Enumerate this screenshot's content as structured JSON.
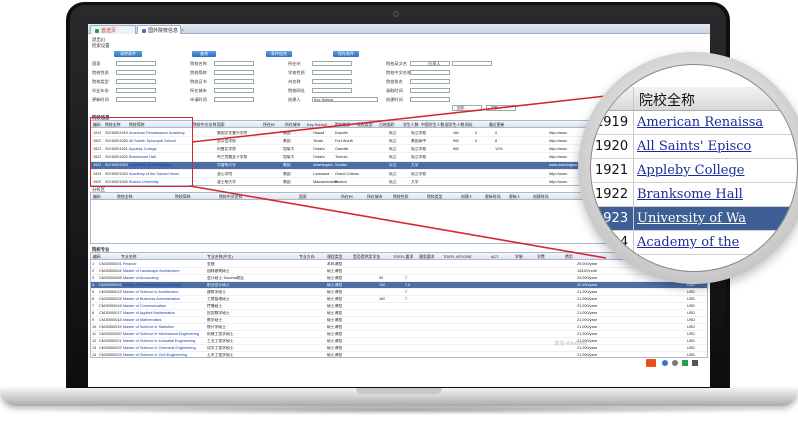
{
  "tabs": [
    {
      "label": "首选页",
      "color": "#2e9a4a"
    },
    {
      "label": "国外院校信息",
      "color": "#3a74c6"
    }
  ],
  "filters": {
    "title": "退出(I)",
    "subtitle": "检索设置",
    "buttons": [
      "清除条件",
      "查询",
      "条件组合",
      "保存条件"
    ],
    "labels": [
      "国家",
      "院校名称",
      "所在州",
      "院校英文名",
      "院校性质",
      "院校简称",
      "学校性质",
      "院校中文名称",
      "院校类型",
      "院校证书",
      "州名称",
      "院校排名",
      "毕业年份",
      "所在城市",
      "院校网址",
      "录取时间",
      "更新时间",
      "申请时间",
      "创建人",
      "创建时间",
      "分享人"
    ],
    "dropdowns": [
      "Key School",
      "- 全部 -",
      "- 全部 -"
    ]
  },
  "school_grid": {
    "section_title": "院校信息",
    "columns": [
      "编码",
      "院校全称",
      "院校简称",
      "院校中文名称",
      "国家",
      "所在州",
      "所在城市",
      "Key School",
      "院校性质",
      "院校类型",
      "占地面积",
      "学生人数",
      "中国学生人数",
      "留学生人数",
      "网址",
      "最近更新"
    ],
    "rows": [
      {
        "no": "1919",
        "code": "SCH0001919",
        "name": "American Renaissance Academy",
        "cn": "美国文艺复兴学院",
        "country": "美国",
        "state": "Hawaii",
        "city": "Kapolei",
        "nature": "私立",
        "type": "私立学校",
        "stu": "160",
        "cn_stu": "0",
        "intl": "0",
        "url": "http://www."
      },
      {
        "no": "1920",
        "code": "SCH0001920",
        "name": "All Saints' Episcopal School",
        "cn": "圣公会学校",
        "country": "美国",
        "state": "Texas",
        "city": "Fort Worth",
        "nature": "私立",
        "type": "美国高中",
        "stu": "900",
        "cn_stu": "0",
        "intl": "8",
        "url": "http://www."
      },
      {
        "no": "1921",
        "code": "SCH0001921",
        "name": "Appleby College",
        "cn": "阿普比学院",
        "country": "加拿大",
        "state": "Ontario",
        "city": "Oakville",
        "nature": "私立",
        "type": "私立学校",
        "stu": "800",
        "cn_stu": "",
        "intl": "12%",
        "url": "http://www."
      },
      {
        "no": "1922",
        "code": "SCH0001922",
        "name": "Branksome Hall",
        "cn": "布兰克森女子学校",
        "country": "加拿大",
        "state": "Ontario",
        "city": "Toronto",
        "nature": "私立",
        "type": "私立学校",
        "stu": "",
        "cn_stu": "",
        "intl": "",
        "url": "http://www."
      },
      {
        "no": "1923",
        "code": "SCH0001923",
        "name": "University of Washington",
        "cn": "华盛顿大学",
        "country": "美国",
        "state": "Washington",
        "city": "Seattle",
        "nature": "公立",
        "type": "大学",
        "stu": "",
        "cn_stu": "",
        "intl": "",
        "url": "www.washington"
      },
      {
        "no": "1924",
        "code": "SCH0001924",
        "name": "Academy of the Sacred Heart",
        "cn": "圣心学院",
        "country": "美国",
        "state": "Louisiana",
        "city": "Grand Coteau",
        "nature": "私立",
        "type": "私立学校",
        "stu": "",
        "cn_stu": "",
        "intl": "",
        "url": "http://www."
      },
      {
        "no": "1925",
        "code": "SCH0001925",
        "name": "Boston University",
        "cn": "波士顿大学",
        "country": "美国",
        "state": "Massachusetts",
        "city": "Boston",
        "nature": "私立",
        "type": "大学",
        "stu": "",
        "cn_stu": "",
        "intl": "",
        "url": "http://www."
      }
    ],
    "selected_index": 4
  },
  "branch_grid": {
    "section_title": "分校区",
    "columns": [
      "编码",
      "院校全称",
      "院校简称",
      "院校中文名称",
      "国家",
      "所在州",
      "所在城市",
      "院校性质",
      "院校类型",
      "创建人",
      "更新时间",
      "更新人",
      "创建时间"
    ]
  },
  "major_grid": {
    "section_title": "院校专业",
    "columns": [
      "编码",
      "专业名称",
      "专业名称(中文)",
      "专业方向",
      "课程类型",
      "是否提供奖学金",
      "TOEFL要求",
      "雅思要求",
      "TOEFL iBT/GRE",
      "ACT",
      "学制",
      "学费",
      "费用"
    ],
    "rows": [
      {
        "code": "CMJ0000001",
        "name": "Finance",
        "cn": "金融",
        "type": "本科课程",
        "toefl": "",
        "ielts": "",
        "fee": "29,000/year",
        "fee2": ""
      },
      {
        "code": "CMJ0000004",
        "name": "Master of Landscape Architecture",
        "cn": "园林建筑硕士",
        "type": "硕士课程",
        "toefl": "",
        "ielts": "",
        "fee": "1443/Credit",
        "fee2": ""
      },
      {
        "code": "CMJ0000008",
        "name": "Master of Accounting",
        "cn": "会计硕士-Tacoma校区",
        "type": "硕士课程",
        "toefl": "90",
        "ielts": "7",
        "fee": "24,000/year",
        "fee2": "USD"
      },
      {
        "code": "CMJ0000012",
        "name": "Master of Professional Accounting",
        "cn": "职业会计硕士",
        "type": "硕士课程",
        "toefl": "100",
        "ielts": "7.0",
        "fee": "32,900/year",
        "fee2": "USD"
      },
      {
        "code": "CMJ0000013",
        "name": "Master of Science in Architecture",
        "cn": "建筑学硕士",
        "type": "硕士课程",
        "toefl": "",
        "ielts": "7",
        "fee": "21,000/year",
        "fee2": "USD"
      },
      {
        "code": "CMJ0000015",
        "name": "Master of Business Administration",
        "cn": "工商管理硕士",
        "type": "硕士课程",
        "toefl": "100",
        "ielts": "7",
        "fee": "21,000/year",
        "fee2": "USD"
      },
      {
        "code": "CMJ0000016",
        "name": "Master of Communication",
        "cn": "传播硕士",
        "type": "硕士课程",
        "toefl": "",
        "ielts": "",
        "fee": "21,000/year",
        "fee2": "USD"
      },
      {
        "code": "CMJ0000017",
        "name": "Master of Applied Mathematics",
        "cn": "应用数学硕士",
        "type": "硕士课程",
        "toefl": "",
        "ielts": "",
        "fee": "21,000/year",
        "fee2": "USD"
      },
      {
        "code": "CMJ0000018",
        "name": "Master of Mathematics",
        "cn": "数学硕士",
        "type": "硕士课程",
        "toefl": "",
        "ielts": "",
        "fee": "21,000/year",
        "fee2": "USD"
      },
      {
        "code": "CMJ0000019",
        "name": "Master of Science in Statistics",
        "cn": "统计学硕士",
        "type": "硕士课程",
        "toefl": "",
        "ielts": "",
        "fee": "21,000/year",
        "fee2": "USD"
      },
      {
        "code": "CMJ0000020",
        "name": "Master of Science in Mechanical Engineering",
        "cn": "机械工程学硕士",
        "type": "硕士课程",
        "toefl": "",
        "ielts": "",
        "fee": "21,000/year",
        "fee2": "USD"
      },
      {
        "code": "CMJ0000021",
        "name": "Master of Science in Industrial Engineering",
        "cn": "工业工程学硕士",
        "type": "硕士课程",
        "toefl": "",
        "ielts": "",
        "fee": "21,000/year",
        "fee2": "USD"
      },
      {
        "code": "CMJ0000022",
        "name": "Master of Science in Chemical Engineering",
        "cn": "化学工程学硕士",
        "type": "硕士课程",
        "toefl": "",
        "ielts": "",
        "fee": "21,000/year",
        "fee2": "USD"
      },
      {
        "code": "CMJ0000023",
        "name": "Master of Science in Civil Engineering",
        "cn": "土木工程学硕士",
        "type": "硕士课程",
        "toefl": "",
        "ielts": "",
        "fee": "21,000/year",
        "fee2": "USD"
      }
    ],
    "selected_index": 3
  },
  "watermark": "激活 Windows",
  "magnifier": {
    "header": "院校全称",
    "rows": [
      {
        "id": "1919",
        "name": "American Renaissa"
      },
      {
        "id": "1920",
        "name": "All Saints' Episco"
      },
      {
        "id": "1921",
        "name": "Appleby College"
      },
      {
        "id": "1922",
        "name": "Branksome Hall"
      },
      {
        "id": "1923",
        "name": "University of Wa"
      },
      {
        "id": "1924",
        "name": "Academy of the"
      }
    ],
    "selected_index": 4
  },
  "colors": {
    "accent": "#d7262e",
    "selection": "#4b6ea5",
    "header_blue": "#2f73c0"
  }
}
